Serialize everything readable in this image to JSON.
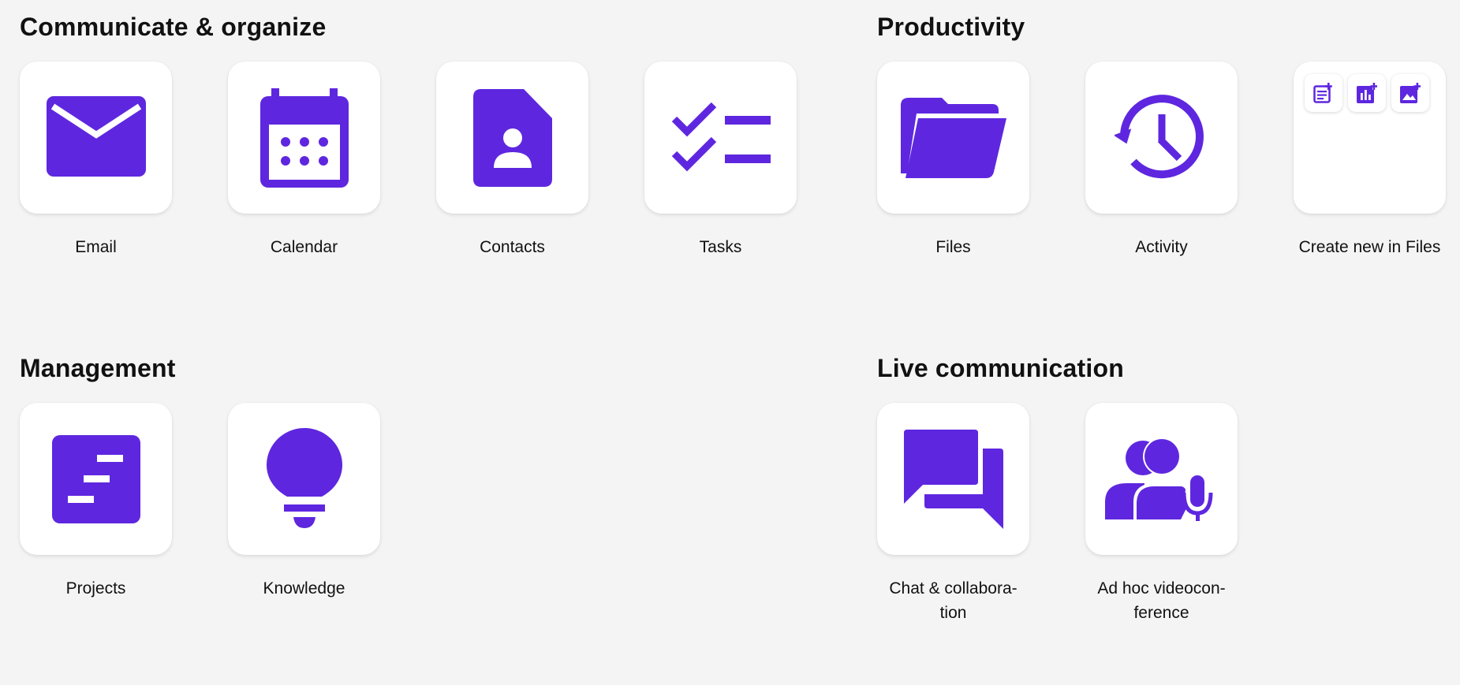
{
  "accent_color": "#5e27df",
  "sections": {
    "communicate": {
      "title": "Communicate & organize",
      "tiles": [
        {
          "label": "Email",
          "icon": "envelope-icon"
        },
        {
          "label": "Calendar",
          "icon": "calendar-icon"
        },
        {
          "label": "Contacts",
          "icon": "contact-card-icon"
        },
        {
          "label": "Tasks",
          "icon": "checklist-icon"
        }
      ]
    },
    "productivity": {
      "title": "Productivity",
      "tiles": [
        {
          "label": "Files",
          "icon": "folder-open-icon"
        },
        {
          "label": "Activity",
          "icon": "history-clock-icon"
        },
        {
          "label": "Create new in Files",
          "icon": "create-new-panel",
          "actions": [
            {
              "icon": "new-document-icon"
            },
            {
              "icon": "new-spreadsheet-icon"
            },
            {
              "icon": "new-image-icon"
            }
          ]
        }
      ]
    },
    "management": {
      "title": "Management",
      "tiles": [
        {
          "label": "Projects",
          "icon": "project-board-icon"
        },
        {
          "label": "Knowledge",
          "icon": "lightbulb-icon"
        }
      ]
    },
    "live": {
      "title": "Live communication",
      "tiles": [
        {
          "label_line1": "Chat & collabora-",
          "label_line2": "tion",
          "icon": "chat-bubbles-icon"
        },
        {
          "label_line1": "Ad hoc videocon-",
          "label_line2": "ference",
          "icon": "video-conference-icon"
        }
      ]
    }
  }
}
